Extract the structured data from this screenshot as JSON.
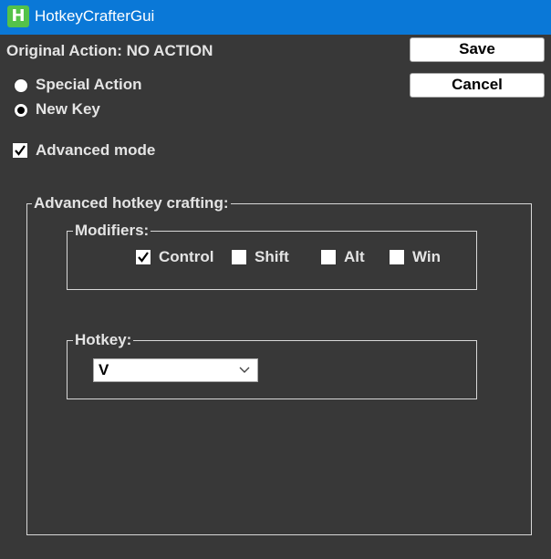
{
  "window": {
    "icon_letter": "H",
    "title": "HotkeyCrafterGui"
  },
  "original_action": "Original Action: NO ACTION",
  "buttons": {
    "save": "Save",
    "cancel": "Cancel"
  },
  "mode_options": [
    {
      "label": "Special Action",
      "selected": false
    },
    {
      "label": "New Key",
      "selected": true
    }
  ],
  "advanced_mode": {
    "label": "Advanced mode",
    "checked": true
  },
  "advanced_group": {
    "title": "Advanced hotkey crafting:",
    "modifiers": {
      "title": "Modifiers:",
      "items": [
        {
          "label": "Control",
          "checked": true
        },
        {
          "label": "Shift",
          "checked": false
        },
        {
          "label": "Alt",
          "checked": false
        },
        {
          "label": "Win",
          "checked": false
        }
      ]
    },
    "hotkey": {
      "title": "Hotkey:",
      "selected": "V",
      "chevron_icon": "chevron-down-icon"
    }
  }
}
